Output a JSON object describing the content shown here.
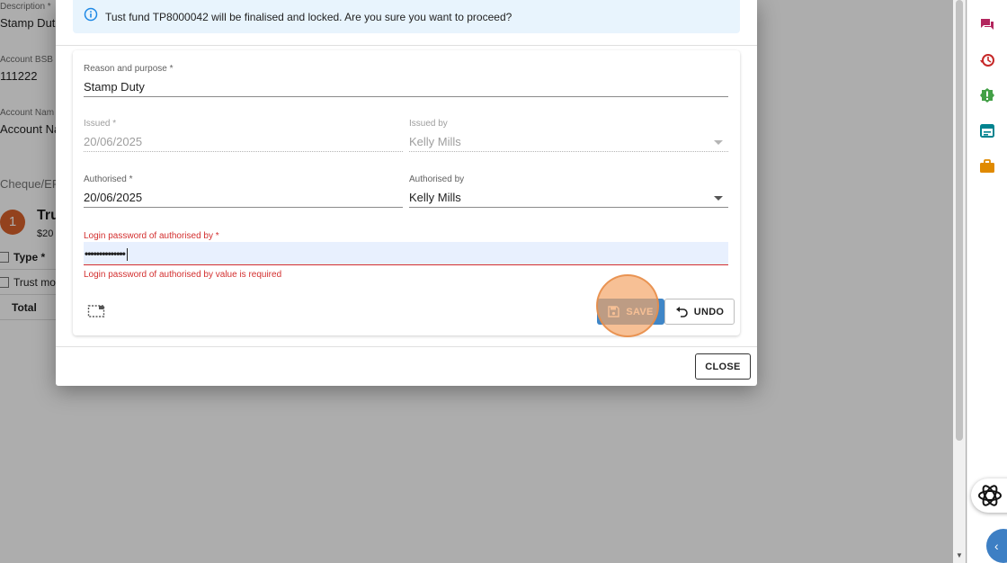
{
  "background": {
    "description_label": "Description *",
    "description_value": "Stamp Dut",
    "bsb_label": "Account BSB",
    "bsb_value": "111222",
    "account_name_label": "Account Nam",
    "account_name_value": "Account Na",
    "cheque_label": "Cheque/EF",
    "step_number": "1",
    "section_title": "Tru",
    "amount": "$20",
    "table": {
      "type_header": "Type *",
      "row_type": "Trust mor",
      "total_label": "Total"
    }
  },
  "modal": {
    "alert_text": "Tust fund TP8000042 will be finalised and locked. Are you sure you want to proceed?",
    "reason": {
      "label": "Reason and purpose *",
      "value": "Stamp Duty"
    },
    "issued": {
      "label": "Issued *",
      "value": "20/06/2025"
    },
    "issued_by": {
      "label": "Issued by",
      "value": "Kelly Mills"
    },
    "authorised": {
      "label": "Authorised *",
      "value": "20/06/2025"
    },
    "authorised_by": {
      "label": "Authorised by",
      "value": "Kelly Mills"
    },
    "password": {
      "label": "Login password of authorised by *",
      "value": "••••••••••••••",
      "error": "Login password of authorised by value is required"
    },
    "save_label": "SAVE",
    "undo_label": "UNDO",
    "close_label": "CLOSE"
  },
  "colors": {
    "primary": "#3f86c7",
    "error": "#d32f2f",
    "alert_bg": "#e8f4fd",
    "step_badge": "#d9622b"
  },
  "icons": [
    "info-icon",
    "save-icon",
    "undo-icon",
    "scan-icon",
    "chat-icon",
    "history-icon",
    "alert-icon",
    "calendar-icon",
    "briefcase-icon",
    "ai-assistant-icon",
    "chevron-left-icon"
  ]
}
